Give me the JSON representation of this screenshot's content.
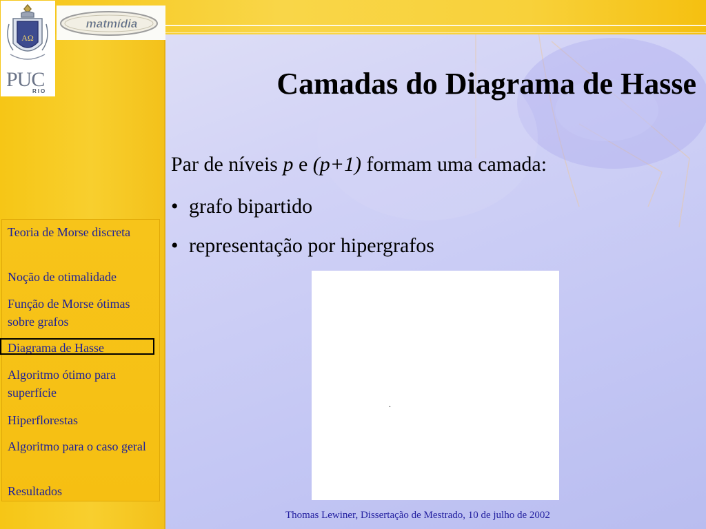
{
  "logos": {
    "puc": "PUC",
    "puc_rio": "RIO",
    "matmidia": "matmídia"
  },
  "title": "Camadas do Diagrama de Hasse",
  "body": {
    "line1": {
      "a": "Par de níveis ",
      "p": "p",
      "b": " e ",
      "p1": "(p+1)",
      "c": " formam uma camada:"
    },
    "bullets": [
      "grafo bipartido",
      "representação por hipergrafos"
    ],
    "bullet_char": "•",
    "figure_mark": "."
  },
  "nav": {
    "items": [
      "Teoria de Morse discreta",
      "Noção de otimalidade",
      "Função de Morse ótimas sobre grafos",
      "Diagrama de Hasse",
      "Algoritmo ótimo para superfície",
      "Hiperflorestas",
      "Algoritmo para o caso geral",
      "Resultados"
    ],
    "current": "Diagrama de Hasse"
  },
  "footer": "Thomas Lewiner, Dissertação de Mestrado, 10 de julho de 2002",
  "colors": {
    "sidebar": "#f6c616",
    "nav_text": "#1b1f9a",
    "background": "#c9ccf2"
  }
}
